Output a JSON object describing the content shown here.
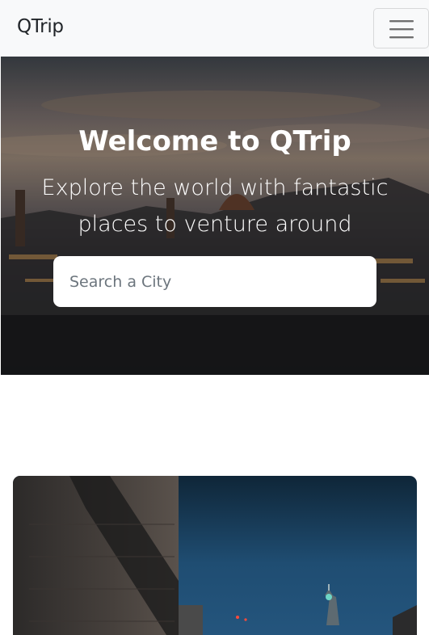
{
  "navbar": {
    "brand": "QTrip",
    "toggler_icon": "hamburger-icon"
  },
  "hero": {
    "title": "Welcome to QTrip",
    "subtitle": "Explore the world with fantastic places to venture around",
    "search": {
      "placeholder": "Search a City",
      "value": ""
    }
  },
  "colors": {
    "navbar_bg": "#f8f9fa",
    "text_dark": "#212529",
    "hero_text": "#ffffff"
  }
}
